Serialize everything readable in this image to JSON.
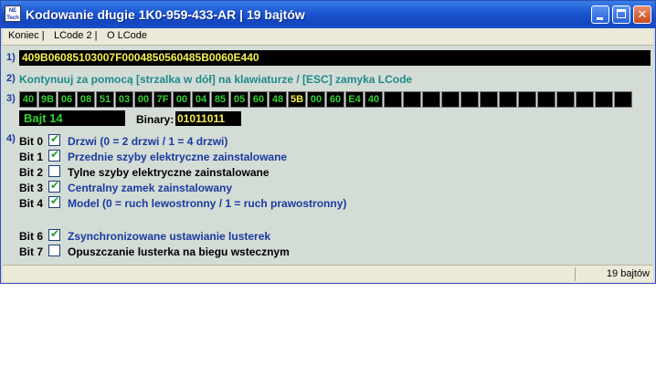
{
  "window": {
    "title": "Kodowanie długie  1K0-959-433-AR | 19 bajtów",
    "icon_text_top": "NE",
    "icon_text_bottom": "Tech"
  },
  "menu": [
    "Koniec |",
    "LCode 2 |",
    "O LCode"
  ],
  "row_labels": [
    "1)",
    "2)",
    "3)",
    "4)"
  ],
  "coding_string": "409B06085103007F0004850560485B0060E440",
  "hint": "Kontynuuj za pomocą [strzalka w dół] na klawiaturze / [ESC] zamyka LCode",
  "bytes": [
    "40",
    "9B",
    "06",
    "08",
    "51",
    "03",
    "00",
    "7F",
    "00",
    "04",
    "85",
    "05",
    "60",
    "48",
    "5B",
    "00",
    "60",
    "E4",
    "40"
  ],
  "selected_byte_index": 14,
  "empty_byte_cells": 13,
  "byte_label": "Bajt 14",
  "binary_label": "Binary:",
  "binary_value": "01011011",
  "bits": [
    {
      "label": "Bit 0",
      "checked": true,
      "text": "Drzwi (0 = 2 drzwi / 1 = 4 drzwi)"
    },
    {
      "label": "Bit 1",
      "checked": true,
      "text": "Przednie szyby elektryczne zainstalowane"
    },
    {
      "label": "Bit 2",
      "checked": false,
      "text": "Tylne szyby elektryczne zainstalowane"
    },
    {
      "label": "Bit 3",
      "checked": true,
      "text": "Centralny zamek zainstalowany"
    },
    {
      "label": "Bit 4",
      "checked": true,
      "text": "Model (0 = ruch lewostronny / 1 = ruch prawostronny)"
    },
    {
      "label": "Bit 6",
      "checked": true,
      "text": "Zsynchronizowane ustawianie lusterek"
    },
    {
      "label": "Bit 7",
      "checked": false,
      "text": "Opuszczanie lusterka na biegu wstecznym"
    }
  ],
  "status": "19 bajtów",
  "colors": {
    "titlebar": "#1a55d0",
    "panel": "#d4dcd6",
    "byte_green": "#32d232",
    "highlight_yellow": "#f4ef50",
    "text_blue": "#1a3aa0",
    "hint_teal": "#1f8a8a"
  },
  "icons": {
    "window_buttons": [
      "minimize-icon",
      "maximize-icon",
      "close-icon"
    ],
    "check": "checkmark-icon"
  }
}
